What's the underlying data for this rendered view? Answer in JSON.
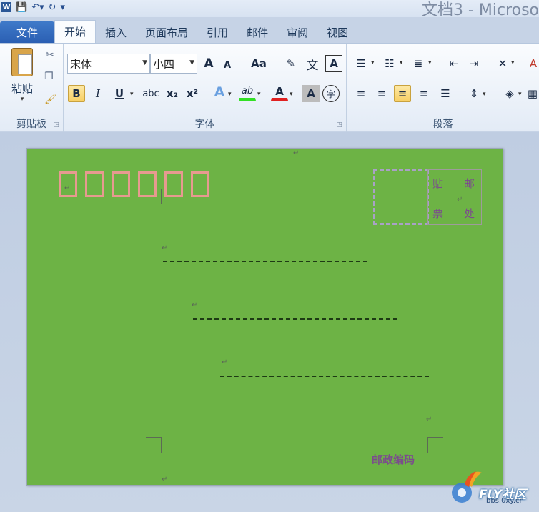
{
  "titlebar": {
    "title": "文档3 - Microso",
    "qat": [
      "word-icon",
      "save-icon",
      "undo-icon",
      "redo-icon",
      "customize-icon"
    ]
  },
  "tabs": [
    {
      "label": "文件"
    },
    {
      "label": "开始"
    },
    {
      "label": "插入"
    },
    {
      "label": "页面布局"
    },
    {
      "label": "引用"
    },
    {
      "label": "邮件"
    },
    {
      "label": "审阅"
    },
    {
      "label": "视图"
    }
  ],
  "ribbon": {
    "clipboard": {
      "label": "剪贴板",
      "paste_label": "粘贴"
    },
    "font": {
      "label": "字体",
      "font_name": "宋体",
      "font_size": "小四",
      "bold": "B",
      "italic": "I",
      "underline": "U",
      "strike": "abc",
      "sub": "x₂",
      "sup": "x²",
      "grow": "A",
      "shrink": "A",
      "case": "Aa",
      "phonetic": "文",
      "border_char": "A",
      "highlight": "ab",
      "font_color": "A",
      "shading": "A",
      "enclose": "字"
    },
    "paragraph": {
      "label": "段落"
    }
  },
  "document": {
    "page_color": "#6db345",
    "stamp_chars": [
      "贴",
      "邮",
      "票",
      "处"
    ],
    "postcode_label": "邮政编码",
    "paragraph_mark": "↵"
  },
  "watermark": {
    "logo_text": "FLY社区",
    "url": "bbs.0xy.cn"
  }
}
